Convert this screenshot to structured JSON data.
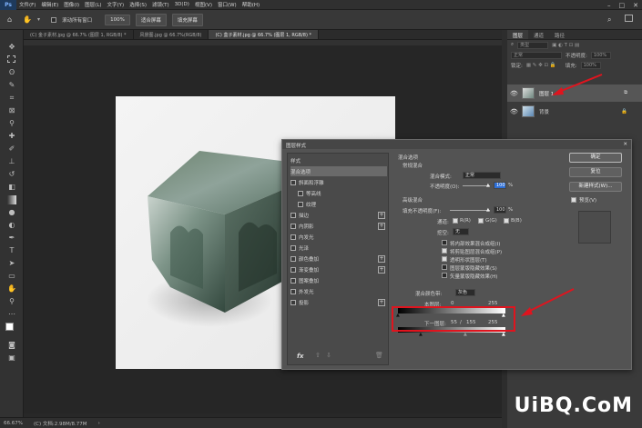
{
  "menubar": {
    "logo": "Ps",
    "items": [
      "文件(F)",
      "编辑(E)",
      "图像(I)",
      "图层(L)",
      "文字(Y)",
      "选择(S)",
      "滤镜(T)",
      "3D(D)",
      "视图(V)",
      "窗口(W)",
      "帮助(H)"
    ]
  },
  "options": {
    "scroll_all": "滚动所有窗口",
    "zoom": "100%",
    "fit_screen": "适合屏幕",
    "fill_screen": "填充屏幕"
  },
  "tabs": [
    {
      "label": "(C) 金子素材.jpg @ 66.7% (图层 1, RGB/8) *",
      "active": false
    },
    {
      "label": "风景图.jpg @ 66.7%(RGB/8)",
      "active": false
    },
    {
      "label": "(C) 盒子素材.jpg @ 66.7% (图层 1, RGB/8) *",
      "active": true
    }
  ],
  "statusbar": {
    "zoom": "66.67%",
    "doc": "(C) 文档:2.98M/8.77M"
  },
  "layers_panel": {
    "tabs": [
      "图层",
      "通道",
      "路径"
    ],
    "kind": "类型",
    "blend": "正常",
    "opacity_label": "不透明度:",
    "opacity_value": "100%",
    "lock_label": "锁定:",
    "fill_label": "填充:",
    "fill_value": "100%",
    "layers": [
      {
        "name": "图层 1",
        "selected": true
      },
      {
        "name": "背景",
        "selected": false
      }
    ]
  },
  "dialog": {
    "title": "图层样式",
    "styles_header": "样式",
    "items": [
      {
        "label": "混合选项",
        "check": false,
        "selected": true,
        "plus": false,
        "indent": false
      },
      {
        "label": "斜面和浮雕",
        "check": true,
        "selected": false,
        "plus": false,
        "indent": false
      },
      {
        "label": "等高线",
        "check": true,
        "selected": false,
        "plus": false,
        "indent": true
      },
      {
        "label": "纹理",
        "check": true,
        "selected": false,
        "plus": false,
        "indent": true
      },
      {
        "label": "描边",
        "check": true,
        "selected": false,
        "plus": true,
        "indent": false
      },
      {
        "label": "内阴影",
        "check": true,
        "selected": false,
        "plus": true,
        "indent": false
      },
      {
        "label": "内发光",
        "check": true,
        "selected": false,
        "plus": false,
        "indent": false
      },
      {
        "label": "光泽",
        "check": true,
        "selected": false,
        "plus": false,
        "indent": false
      },
      {
        "label": "颜色叠加",
        "check": true,
        "selected": false,
        "plus": true,
        "indent": false
      },
      {
        "label": "渐变叠加",
        "check": true,
        "selected": false,
        "plus": true,
        "indent": false
      },
      {
        "label": "图案叠加",
        "check": true,
        "selected": false,
        "plus": false,
        "indent": false
      },
      {
        "label": "外发光",
        "check": true,
        "selected": false,
        "plus": false,
        "indent": false
      },
      {
        "label": "投影",
        "check": true,
        "selected": false,
        "plus": true,
        "indent": false
      }
    ],
    "blend_options_title": "混合选项",
    "general_blend": "常规混合",
    "blend_mode_label": "混合模式:",
    "blend_mode_value": "正常",
    "opacity_label": "不透明度(O):",
    "opacity_value": "100",
    "percent": "%",
    "advanced_blend": "高级混合",
    "fill_opacity_label": "填充不透明度(F):",
    "fill_opacity_value": "100",
    "channels_label": "通道:",
    "ch_r": "R(R)",
    "ch_g": "G(G)",
    "ch_b": "B(B)",
    "knockout_label": "挖空:",
    "knockout_value": "无",
    "opt1": "将内部效果混合成组(I)",
    "opt2": "将剪贴图层混合成组(P)",
    "opt3": "透明形状图层(T)",
    "opt4": "图层蒙版隐藏效果(S)",
    "opt5": "矢量蒙版隐藏效果(H)",
    "blend_if_label": "混合颜色带:",
    "blend_if_value": "灰色",
    "this_layer_label": "本图层:",
    "this_layer_lo": "0",
    "this_layer_hi": "255",
    "under_layer_label": "下一图层:",
    "under_lo": "55",
    "under_sep": "/",
    "under_mid": "155",
    "under_hi": "255",
    "ok": "确定",
    "reset": "复位",
    "new_style": "新建样式(W)...",
    "preview": "预览(V)",
    "fx": "fx"
  },
  "watermark": "UiBQ.CoM"
}
